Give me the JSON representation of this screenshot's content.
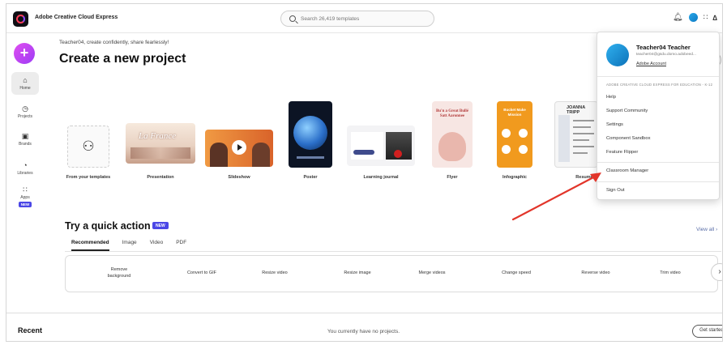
{
  "app": {
    "brand": "Adobe Creative Cloud Express"
  },
  "search": {
    "placeholder": "Search 26,419 templates"
  },
  "sidebar": {
    "items": [
      {
        "label": "Home",
        "icon": "home-icon"
      },
      {
        "label": "Projects",
        "icon": "projects-icon"
      },
      {
        "label": "Brands",
        "icon": "brands-icon"
      },
      {
        "label": "Libraries",
        "icon": "libraries-icon"
      },
      {
        "label": "Apps",
        "icon": "apps-icon",
        "badge": "NEW"
      }
    ]
  },
  "main": {
    "greeting": "Teacher04, create confidently, share fearlessly!",
    "headline": "Create a new project"
  },
  "templates": [
    {
      "label": "From your templates"
    },
    {
      "label": "Presentation",
      "thumb_text": "La France"
    },
    {
      "label": "Slideshow"
    },
    {
      "label": "Poster"
    },
    {
      "label": "Learning journal"
    },
    {
      "label": "Flyer",
      "thumb_text": "Bu'n a Great Bullé Satt Aaronnee"
    },
    {
      "label": "Infographic",
      "thumb_text": "Bucket Make Mission"
    },
    {
      "label": "Resume",
      "thumb_text": "JOANNA TRIPP"
    }
  ],
  "account_menu": {
    "name": "Teacher04 Teacher",
    "email": "teacher04@gsdu.domo.adobeed...",
    "account_link": "Adobe Account",
    "org": "ADOBE CREATIVE CLOUD EXPRESS FOR EDUCATION - K-12",
    "items": [
      "Help",
      "Support Community",
      "Settings",
      "Component Sandbox",
      "Feature Flipper"
    ],
    "classroom": "Classroom Manager",
    "sign_out": "Sign Out"
  },
  "quick_actions": {
    "title": "Try a quick action",
    "badge": "NEW",
    "view_all": "View all",
    "tabs": [
      "Recommended",
      "Image",
      "Video",
      "PDF"
    ],
    "active_tab": "Recommended",
    "items": [
      "Remove background",
      "Convert to GIF",
      "Resize video",
      "Resize image",
      "Merge videos",
      "Change speed",
      "Reverse video",
      "Trim video"
    ]
  },
  "recent": {
    "title": "Recent",
    "empty": "You currently have no projects.",
    "get_started": "Get started"
  },
  "colors": {
    "create_button": "#b042f3",
    "new_badge": "#4b47e6",
    "annotation_arrow": "#e2352a"
  }
}
